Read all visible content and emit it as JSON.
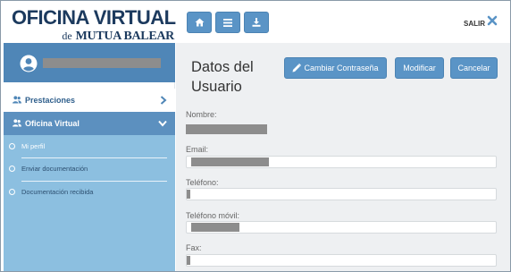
{
  "header": {
    "logo_line1": "OFICINA VIRTUAL",
    "logo_de": "de",
    "logo_brand": "MUTUA BALEAR",
    "toolbar": {
      "home_icon": "home-icon",
      "menu_icon": "menu-icon",
      "download_icon": "download-icon"
    },
    "salir_label": "SALIR",
    "close_icon": "close-icon"
  },
  "colors": {
    "brand_dark": "#1c3a5e",
    "button_blue": "#5a94c6",
    "sidebar_active": "#5c90bf",
    "submenu_bg": "#8cbfe0",
    "main_bg": "#eef0f2"
  },
  "sidebar": {
    "user": {
      "avatar_icon": "user-circle-icon",
      "name": ""
    },
    "items": [
      {
        "label": "Prestaciones",
        "icon": "users-icon",
        "arrow": "chevron-right-icon"
      },
      {
        "label": "Oficina Virtual",
        "icon": "users-icon",
        "arrow": "chevron-down-icon",
        "subitems": [
          {
            "label": "Mi perfil",
            "active": true
          },
          {
            "label": "Enviar documentación",
            "active": false
          },
          {
            "label": "Documentación recibida",
            "active": false
          }
        ]
      }
    ]
  },
  "main": {
    "title": "Datos del Usuario",
    "buttons": {
      "change_password": "Cambiar Contraseña",
      "change_password_icon": "pencil-icon",
      "modify": "Modificar",
      "cancel": "Cancelar"
    },
    "fields": [
      {
        "label": "Nombre:",
        "value": ""
      },
      {
        "label": "Email:",
        "value": ""
      },
      {
        "label": "Teléfono:",
        "value": ""
      },
      {
        "label": "Teléfono móvil:",
        "value": ""
      },
      {
        "label": "Fax:",
        "value": ""
      }
    ]
  }
}
